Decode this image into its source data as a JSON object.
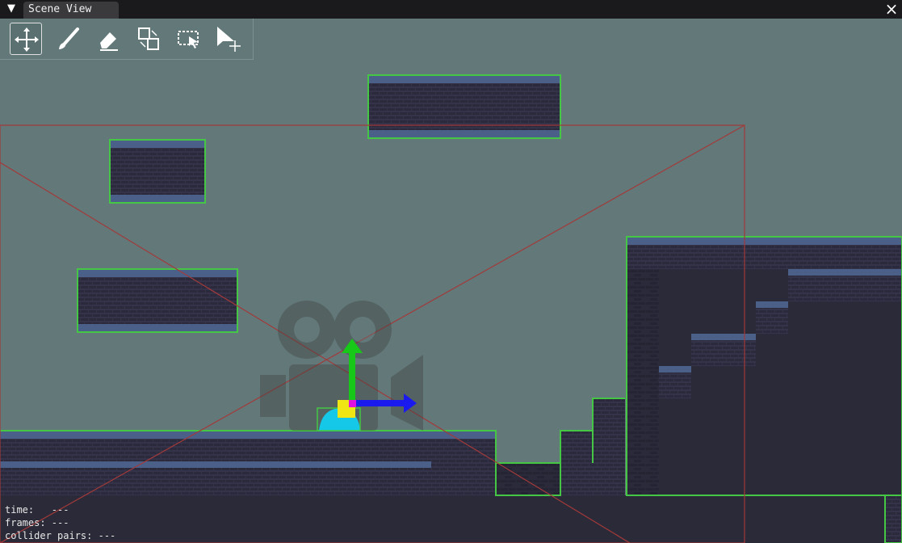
{
  "window": {
    "tab_label": "Scene View",
    "collapse_icon": "triangle-down-icon",
    "close_label": "×"
  },
  "toolbar": {
    "tools": [
      {
        "name": "move-tool",
        "icon": "move-arrows-icon",
        "active": true
      },
      {
        "name": "brush-tool",
        "icon": "brush-icon",
        "active": false
      },
      {
        "name": "eraser-tool",
        "icon": "eraser-icon",
        "active": false
      },
      {
        "name": "swap-tool",
        "icon": "swap-squares-icon",
        "active": false
      },
      {
        "name": "rect-select-tool",
        "icon": "rect-select-icon",
        "active": false
      },
      {
        "name": "pointer-move-tool",
        "icon": "pointer-move-icon",
        "active": false
      }
    ]
  },
  "stats": {
    "time": "time:   ---",
    "frames": "frames: ---",
    "collider_pairs": "collider pairs: ---"
  },
  "colors": {
    "sky": "#627879",
    "brick": "#34334a",
    "brick_top": "#4b6089",
    "collider": "#45c745",
    "camera_bounds": "#a23a3a",
    "gizmo_x": "#1a1aee",
    "gizmo_y": "#18c818",
    "player": "#16c8e8"
  }
}
